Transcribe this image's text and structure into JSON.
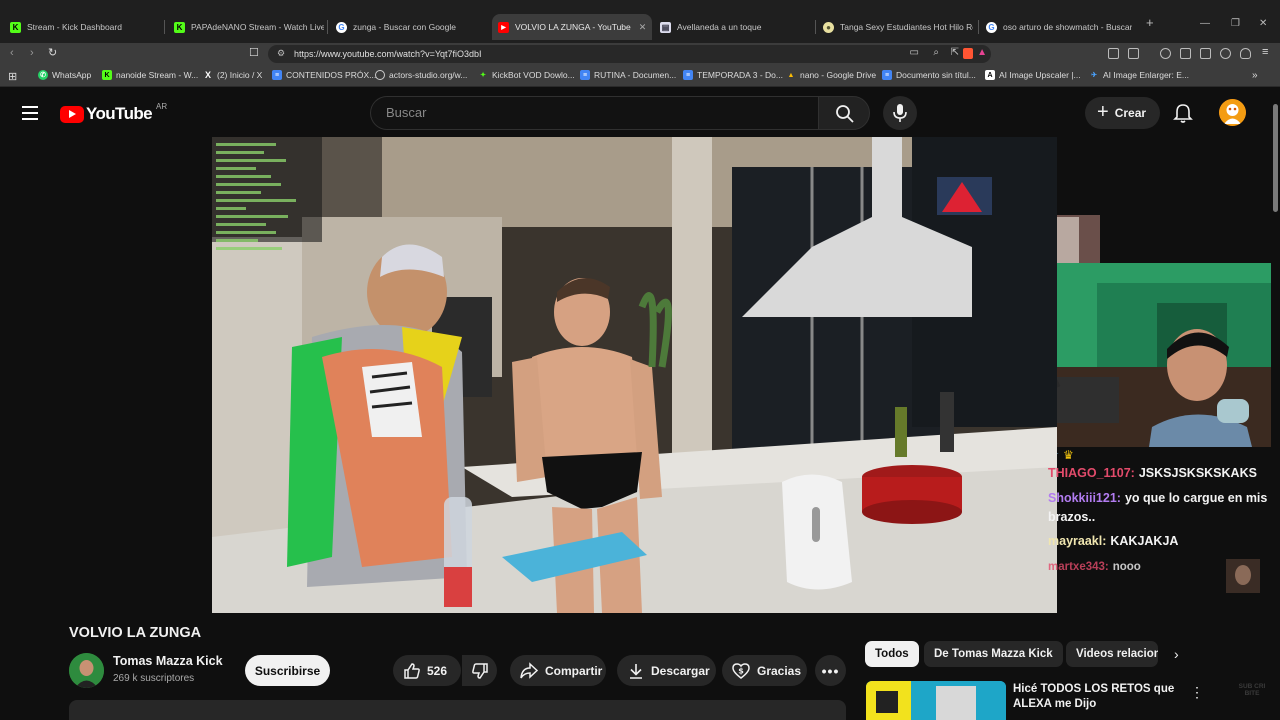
{
  "browser": {
    "tabs": [
      {
        "title": "Stream - Kick Dashboard",
        "icon": "kick-icon"
      },
      {
        "title": "PAPAdeNANO Stream - Watch Live o",
        "icon": "kick-icon"
      },
      {
        "title": "zunga - Buscar con Google",
        "icon": "google-icon"
      },
      {
        "title": "VOLVIO LA ZUNGA - YouTube",
        "icon": "youtube-icon",
        "active": true
      },
      {
        "title": "Avellaneda a un toque",
        "icon": "page-icon"
      },
      {
        "title": "Tanga Sexy Estudiantes Hot Hilo Re",
        "icon": "page-icon"
      },
      {
        "title": "oso arturo de showmatch - Buscar c",
        "icon": "google-icon"
      }
    ],
    "url": "https://www.youtube.com/watch?v=Yqt7fiO3dbI",
    "bookmarks": [
      {
        "label": "WhatsApp",
        "icon": "whatsapp-icon"
      },
      {
        "label": "nanoide Stream - W...",
        "icon": "kick-icon"
      },
      {
        "label": "(2) Inicio / X",
        "icon": "x-icon"
      },
      {
        "label": "CONTENIDOS PRÓX...",
        "icon": "docs-icon"
      },
      {
        "label": "actors-studio.org/w...",
        "icon": "globe-icon"
      },
      {
        "label": "KickBot VOD Dowlo...",
        "icon": "kickbot-icon"
      },
      {
        "label": "RUTINA - Documen...",
        "icon": "docs-icon"
      },
      {
        "label": "TEMPORADA 3 - Do...",
        "icon": "docs-icon"
      },
      {
        "label": "nano - Google Drive",
        "icon": "drive-icon"
      },
      {
        "label": "Documento sin títul...",
        "icon": "docs-icon"
      },
      {
        "label": "AI Image Upscaler |...",
        "icon": "ai-icon"
      },
      {
        "label": "AI Image Enlarger: E...",
        "icon": "ai-icon"
      }
    ]
  },
  "youtube": {
    "logo_text": "YouTube",
    "country_code": "AR",
    "search_placeholder": "Buscar",
    "create_label": "Crear",
    "video": {
      "title": "VOLVIO LA ZUNGA",
      "channel": "Tomas Mazza Kick",
      "subscribers": "269 k suscriptores",
      "subscribe_label": "Suscribirse",
      "likes": "526",
      "share_label": "Compartir",
      "download_label": "Descargar",
      "thanks_label": "Gracias"
    },
    "chips": [
      "Todos",
      "De Tomas Mazza Kick",
      "Videos relacion"
    ],
    "recommendation": {
      "title": "Hicé TODOS LOS RETOS que ALEXA me Dijo"
    },
    "watermark": "SUB CRI BITE"
  },
  "stream_chat": [
    {
      "user": "THIAGO_1107:",
      "message": "JSKSJSKSKSKAKS",
      "color": "#e34b6b"
    },
    {
      "user": "Shokkiii121:",
      "message": "yo que lo cargue en mis brazos..",
      "color": "#b27cf0"
    },
    {
      "user": "mayraakl:",
      "message": "KAKJAKJA",
      "color": "#f0e6b0"
    },
    {
      "user": "martxe343:",
      "message": "nooo",
      "color": "#e34b6b"
    }
  ],
  "colors": {
    "background": "#0f0f0f",
    "youtube_red": "#ff0000",
    "chip_bg": "#272727",
    "text": "#f1f1f1"
  }
}
